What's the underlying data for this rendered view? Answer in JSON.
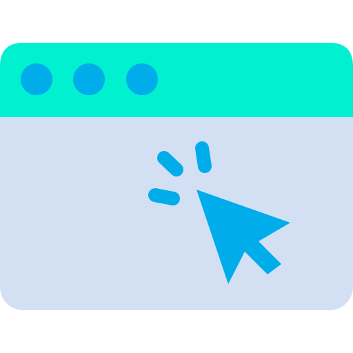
{
  "illustration": {
    "subject": "browser-window-click-icon",
    "colors": {
      "window_body": "#D3E0F4",
      "title_bar": "#00F0D0",
      "window_dots": "#00ACEA",
      "cursor": "#00ACEA",
      "click_marks": "#00ACEA",
      "background": "#FFFFFF"
    },
    "window_dot_count": 3,
    "click_mark_count": 3,
    "icons": [
      "browser-window-icon",
      "mouse-pointer-icon",
      "click-burst-icon"
    ]
  }
}
